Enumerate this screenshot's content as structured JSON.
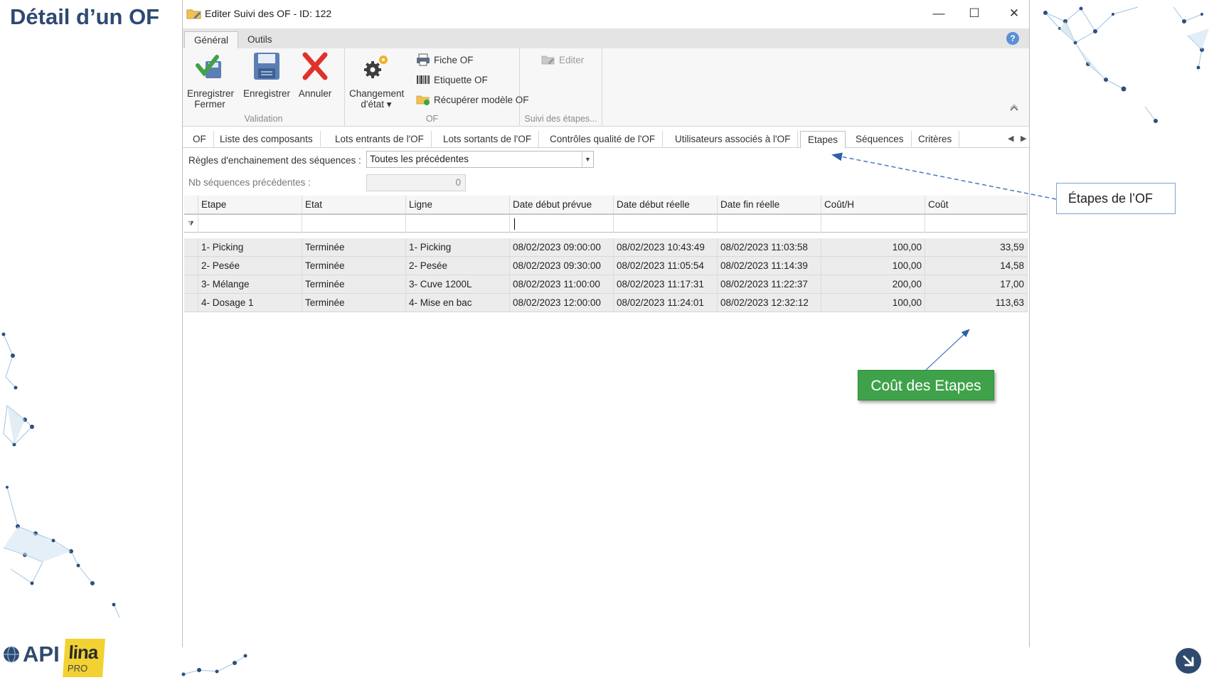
{
  "slide": {
    "title": "Détail d’un OF"
  },
  "window": {
    "title": "Editer Suivi des OF - ID: 122",
    "title_icon": "folder-edit-icon",
    "controls": {
      "minimize": "—",
      "maximize": "☐",
      "close": "✕"
    }
  },
  "ribbon": {
    "tabs": [
      {
        "label": "Général",
        "active": true
      },
      {
        "label": "Outils",
        "active": false
      }
    ],
    "groups": {
      "validation": {
        "label": "Validation",
        "buttons": [
          {
            "label_line1": "Enregistrer",
            "label_line2": "Fermer",
            "icon": "save-close-icon"
          },
          {
            "label_line1": "Enregistrer",
            "label_line2": "",
            "icon": "floppy-disk-icon"
          },
          {
            "label_line1": "Annuler",
            "label_line2": "",
            "icon": "red-cross-icon"
          }
        ]
      },
      "of": {
        "label": "OF",
        "change_state": {
          "label_line1": "Changement",
          "label_line2": "d'état ▾",
          "icon": "gears-icon"
        },
        "small_buttons": [
          {
            "label": "Fiche OF",
            "icon": "printer-icon"
          },
          {
            "label": "Etiquette OF",
            "icon": "barcode-icon"
          },
          {
            "label": "Récupérer modèle OF",
            "icon": "folder-green-icon"
          }
        ]
      },
      "suivi": {
        "label": "Suivi des étapes...",
        "edit_label": "Editer",
        "edit_icon": "folder-edit-icon"
      }
    }
  },
  "doc_tabs": [
    {
      "label": "OF",
      "active": false
    },
    {
      "label": "Liste des composants",
      "active": false
    },
    {
      "label": "Lots entrants de l'OF",
      "active": false
    },
    {
      "label": "Lots sortants de l'OF",
      "active": false
    },
    {
      "label": "Contrôles qualité de l'OF",
      "active": false
    },
    {
      "label": "Utilisateurs associés à l'OF",
      "active": false
    },
    {
      "label": "Etapes",
      "active": true
    },
    {
      "label": "Séquences",
      "active": false
    },
    {
      "label": "Critères",
      "active": false
    }
  ],
  "form": {
    "rules_label": "Règles d'enchainement des séquences :",
    "rules_value": "Toutes les précédentes",
    "nb_label": "Nb séquences précédentes :",
    "nb_value": "0"
  },
  "grid": {
    "columns": [
      "Etape",
      "Etat",
      "Ligne",
      "Date début prévue",
      "Date début réelle",
      "Date fin réelle",
      "Coût/H",
      "Coût"
    ],
    "rows": [
      [
        "1- Picking",
        "Terminée",
        "1- Picking",
        "08/02/2023 09:00:00",
        "08/02/2023 10:43:49",
        "08/02/2023 11:03:58",
        "100,00",
        "33,59"
      ],
      [
        "2- Pesée",
        "Terminée",
        "2- Pesée",
        "08/02/2023 09:30:00",
        "08/02/2023 11:05:54",
        "08/02/2023 11:14:39",
        "100,00",
        "14,58"
      ],
      [
        "3- Mélange",
        "Terminée",
        "3- Cuve 1200L",
        "08/02/2023 11:00:00",
        "08/02/2023 11:17:31",
        "08/02/2023 11:22:37",
        "200,00",
        "17,00"
      ],
      [
        "4- Dosage 1",
        "Terminée",
        "4- Mise en bac",
        "08/02/2023 12:00:00",
        "08/02/2023 11:24:01",
        "08/02/2023 12:32:12",
        "100,00",
        "113,63"
      ]
    ]
  },
  "callouts": {
    "etapes": "Étapes de l’OF",
    "cout": "Coût des Etapes"
  },
  "logos": {
    "api": "API",
    "lina": "lina",
    "lina_sub": "PRO"
  },
  "colors": {
    "title": "#2e4a72",
    "callout_green": "#3fa24a",
    "callout_border": "#7ea2cc"
  }
}
